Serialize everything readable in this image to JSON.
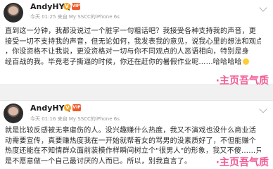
{
  "posts": [
    {
      "author": "AndyHYQ",
      "verified_mark": "V",
      "vip_mark": "VIP",
      "meta": "今天 01:25 来自 My SSCC的iPhone 6s",
      "lines": [
        "直到这一分钟，我都没说过一个脏字一句粗话吧？我接受各种支持我的声音，更",
        "接受一切不支持我的声音，但无论如何，我发表我的意见，说我心里的想法和观点",
        "，你没资格不让我说，更没资格对一切与你不同观点的人恶语相向，特别是身",
        "经百战的我。毕竟老子撕逼的时候，你还在赶你的暑假作业呢……哈哈哈哈"
      ]
    },
    {
      "author": "AndyHYQ",
      "verified_mark": "V",
      "vip_mark": "VIP",
      "meta": "今天 01:16 来自 My SSCC的iPhone 6s",
      "lines": [
        "就是比较反感被无辜虐伤的人。没兴趣赚什么热度，我又不演戏也没什么商业活",
        "动需要宣传，真要赚热度我在一开始就帮着女的骂男的没素质好了，不但能赚个",
        "热度还能在不知情群众面前装模作样瞬间树立个\"很男人\"的形象，我又不傻……只",
        "是不愿意做一个自己最讨厌的人而已。所以，别我直言了。"
      ]
    }
  ],
  "watermark": "·主页吾气质",
  "colors": {
    "name": "#1a1a1a",
    "meta": "#999999",
    "text": "#2b2b2b",
    "divider": "#f1f1f1",
    "verified": "#f6a623",
    "vip": "#f05a28",
    "watermark": "#f04e8c"
  },
  "icons": [
    "avatar",
    "verified-v-icon",
    "vip-badge-icon",
    "chevron-down-icon",
    "smiley-emoji-icon"
  ]
}
